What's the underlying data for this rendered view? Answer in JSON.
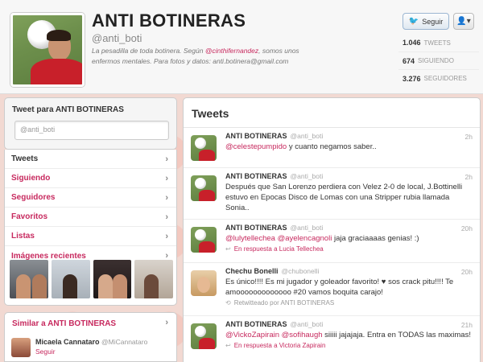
{
  "profile": {
    "name": "ANTI BOTINERAS",
    "handle": "@anti_boti",
    "bio_before": "La pesadilla de toda botinera. Según ",
    "bio_mention": "@cinthifernandez",
    "bio_after": ", somos unos enfermos mentales. Para fotos y datos: anti.botinera@gmail.com",
    "follow_label": "Seguir",
    "user_menu_icon": "person-dropdown-icon"
  },
  "stats": [
    {
      "value": "1.046",
      "label": "TWEETS"
    },
    {
      "value": "674",
      "label": "SIGUIENDO"
    },
    {
      "value": "3.276",
      "label": "SEGUIDORES"
    }
  ],
  "compose": {
    "title": "Tweet para ANTI BOTINERAS",
    "placeholder": "@anti_boti"
  },
  "nav": {
    "tweets": "Tweets",
    "following": "Siguiendo",
    "followers": "Seguidores",
    "favorites": "Favoritos",
    "lists": "Listas",
    "recent_images": "Imágenes recientes"
  },
  "similar": {
    "title": "Similar a ANTI BOTINERAS",
    "name": "Micaela Cannataro",
    "handle": "@MiCannataro",
    "follow": "Seguir"
  },
  "timeline": {
    "title": "Tweets",
    "tweets": [
      {
        "author": "ANTI BOTINERAS",
        "handle": "@anti_boti",
        "time": "2h",
        "mention": "@celestepumpido",
        "text": " y cuanto negamos saber..",
        "meta": ""
      },
      {
        "author": "ANTI BOTINERAS",
        "handle": "@anti_boti",
        "time": "2h",
        "mention": "",
        "text": "Después que San Lorenzo perdiera con Velez 2-0 de local, J.Bottinelli estuvo en Epocas Disco de Lomas con una Stripper rubia llamada Sonia..",
        "meta": ""
      },
      {
        "author": "ANTI BOTINERAS",
        "handle": "@anti_boti",
        "time": "20h",
        "mention": "@lulytellechea @ayelencagnoli",
        "text": " jaja graciaaaas genias! :)",
        "meta": "En respuesta a Lucia Tellechea"
      },
      {
        "author": "Chechu Bonelli",
        "handle": "@chubonelli",
        "time": "20h",
        "mention": "",
        "text": "Es único!!!! Es mi jugador y goleador favorito! ♥ sos crack pitu!!!! Te amooooooooooooo #20 vamos boquita carajo!",
        "meta": "Retwitteado por ANTI BOTINERAS"
      },
      {
        "author": "ANTI BOTINERAS",
        "handle": "@anti_boti",
        "time": "21h",
        "mention": "@VickoZapirain @sofihaugh",
        "text": " siiiii jajajaja. Entra en TODAS las maximas!",
        "meta": "En respuesta a Victoria Zapirain"
      }
    ]
  }
}
